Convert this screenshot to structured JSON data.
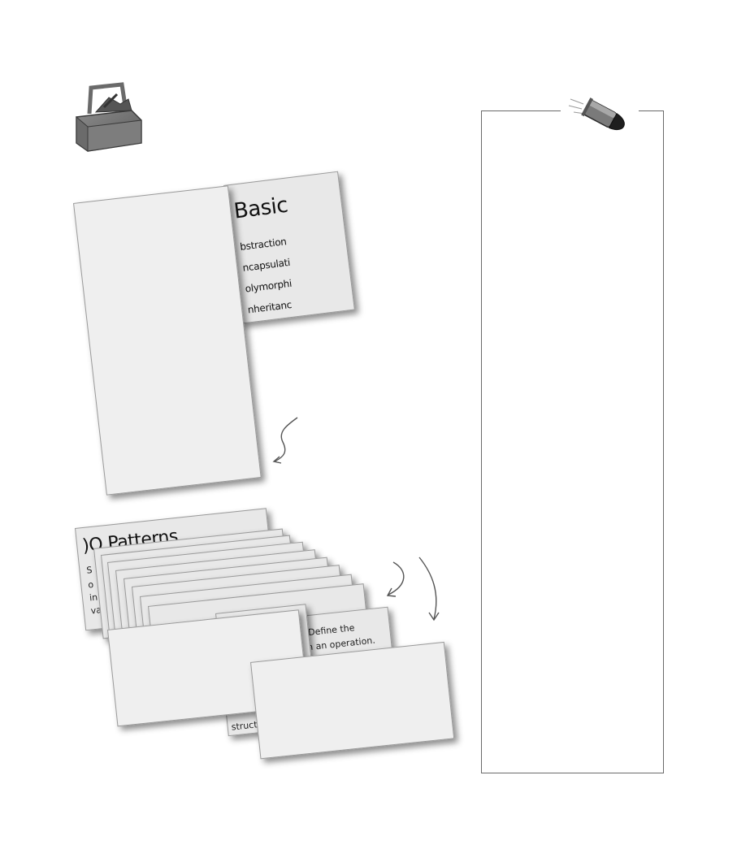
{
  "basic_card": {
    "title": "Basic",
    "items": [
      "bstraction",
      "ncapsulati",
      "olymorphi",
      "nheritanc"
    ]
  },
  "oo_patterns_card": {
    "title": ")O Patterns"
  },
  "stack_fragments": {
    "object_text": "object",
    "define_text": "Define the",
    "operation_text": "in an operation.",
    "structure_text": "structure"
  },
  "icons": [
    "toolbox-icon",
    "bullet-icon",
    "curved-arrow-icon"
  ]
}
